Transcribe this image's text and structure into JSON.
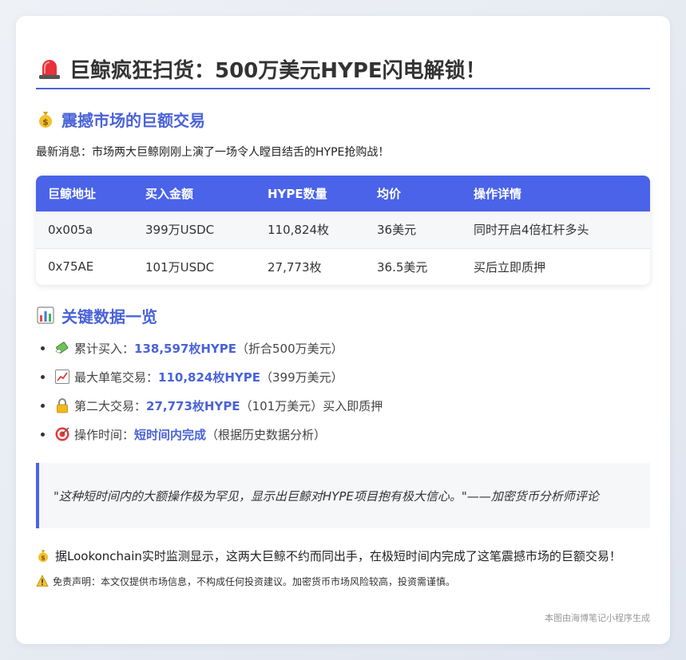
{
  "title": "巨鲸疯狂扫货：500万美元HYPE闪电解锁！",
  "section1": {
    "heading": "震撼市场的巨额交易",
    "lead": "最新消息：市场两大巨鲸刚刚上演了一场令人瞠目结舌的HYPE抢购战！"
  },
  "table": {
    "headers": [
      "巨鲸地址",
      "买入金额",
      "HYPE数量",
      "均价",
      "操作详情"
    ],
    "rows": [
      [
        "0x005a",
        "399万USDC",
        "110,824枚",
        "36美元",
        "同时开启4倍杠杆多头"
      ],
      [
        "0x75AE",
        "101万USDC",
        "27,773枚",
        "36.5美元",
        "买后立即质押"
      ]
    ]
  },
  "section2": {
    "heading": "关键数据一览",
    "items": [
      {
        "icon": "money-wings-icon",
        "label": "累计买入：",
        "highlight": "138,597枚HYPE",
        "rest": "（折合500万美元）"
      },
      {
        "icon": "chart-up-icon",
        "label": "最大单笔交易：",
        "highlight": "110,824枚HYPE",
        "rest": "（399万美元）"
      },
      {
        "icon": "lock-icon",
        "label": "第二大交易：",
        "highlight": "27,773枚HYPE",
        "rest": "（101万美元）买入即质押"
      },
      {
        "icon": "target-icon",
        "label": "操作时间：",
        "highlight": "短时间内完成",
        "rest": "（根据历史数据分析）"
      }
    ]
  },
  "quote": "\"这种短时间内的大额操作极为罕见，显示出巨鲸对HYPE项目抱有极大信心。\"——加密货币分析师评论",
  "note": "据Lookonchain实时监测显示，这两大巨鲸不约而同出手，在极短时间内完成了这笔震撼市场的巨额交易！",
  "disclaimer": "免责声明：本文仅提供市场信息，不构成任何投资建议。加密货币市场风险较高，投资需谨慎。",
  "footer": "本图由海博笔记小程序生成",
  "colors": {
    "accent": "#4a63d9",
    "table_header": "#4a63e8"
  }
}
